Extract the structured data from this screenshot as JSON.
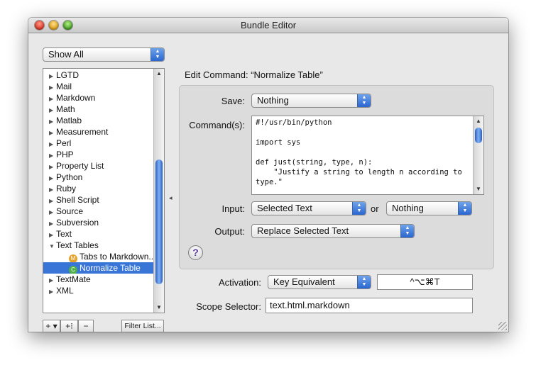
{
  "window": {
    "title": "Bundle Editor"
  },
  "filter": {
    "selected": "Show All"
  },
  "bundles": [
    {
      "label": "LGTD",
      "kind": "bundle",
      "expanded": false
    },
    {
      "label": "Mail",
      "kind": "bundle",
      "expanded": false
    },
    {
      "label": "Markdown",
      "kind": "bundle",
      "expanded": false
    },
    {
      "label": "Math",
      "kind": "bundle",
      "expanded": false
    },
    {
      "label": "Matlab",
      "kind": "bundle",
      "expanded": false
    },
    {
      "label": "Measurement",
      "kind": "bundle",
      "expanded": false
    },
    {
      "label": "Perl",
      "kind": "bundle",
      "expanded": false
    },
    {
      "label": "PHP",
      "kind": "bundle",
      "expanded": false
    },
    {
      "label": "Property List",
      "kind": "bundle",
      "expanded": false
    },
    {
      "label": "Python",
      "kind": "bundle",
      "expanded": false
    },
    {
      "label": "Ruby",
      "kind": "bundle",
      "expanded": false
    },
    {
      "label": "Shell Script",
      "kind": "bundle",
      "expanded": false
    },
    {
      "label": "Source",
      "kind": "bundle",
      "expanded": false
    },
    {
      "label": "Subversion",
      "kind": "bundle",
      "expanded": false
    },
    {
      "label": "Text",
      "kind": "bundle",
      "expanded": false
    },
    {
      "label": "Text Tables",
      "kind": "bundle",
      "expanded": true
    },
    {
      "label": "Tabs to Markdown...",
      "kind": "macro",
      "badge": "M"
    },
    {
      "label": "Normalize Table",
      "kind": "command",
      "badge": "C",
      "selected": true
    },
    {
      "label": "TextMate",
      "kind": "bundle",
      "expanded": false
    },
    {
      "label": "XML",
      "kind": "bundle",
      "expanded": false
    }
  ],
  "bottom_buttons": {
    "add": "+ ▾",
    "add_item": "+⁝",
    "remove": "−",
    "filter_list": "Filter List..."
  },
  "editor": {
    "heading": "Edit Command: “Normalize Table”",
    "save_label": "Save:",
    "save_value": "Nothing",
    "commands_label": "Command(s):",
    "code": "#!/usr/bin/python\n\nimport sys\n\ndef just(string, type, n):\n    \"Justify a string to length n according to type.\"",
    "input_label": "Input:",
    "input_value": "Selected Text",
    "or_label": "or",
    "input_fallback": "Nothing",
    "output_label": "Output:",
    "output_value": "Replace Selected Text",
    "help": "?",
    "activation_label": "Activation:",
    "activation_value": "Key Equivalent",
    "key_equivalent": "^⌥⌘T",
    "scope_label": "Scope Selector:",
    "scope_value": "text.html.markdown"
  },
  "colors": {
    "selection": "#3875d7",
    "accent": "#2a66cf"
  }
}
